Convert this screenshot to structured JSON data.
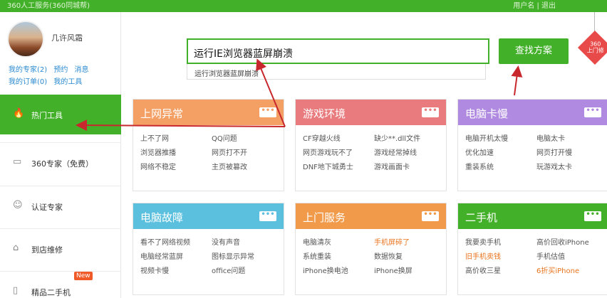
{
  "topbar": {
    "left_text": "360人工服务(360同城帮)",
    "right_text": "用户名 | 退出"
  },
  "user": {
    "name": "几许风霜",
    "links_row1": [
      "我的专家(2)",
      "预约",
      "消息"
    ],
    "links_row2": [
      "我的订单(0)",
      "我的工具"
    ]
  },
  "nav": [
    {
      "label": "热门工具",
      "icon": "fire-icon",
      "glyph": "🔥"
    },
    {
      "label": "360专家（免费）",
      "icon": "monitor-icon",
      "glyph": "▭"
    },
    {
      "label": "认证专家",
      "icon": "person-icon",
      "glyph": "☺"
    },
    {
      "label": "到店维修",
      "icon": "store-icon",
      "glyph": "⌂"
    },
    {
      "label": "精品二手机",
      "icon": "phone-icon",
      "glyph": "▯",
      "badge": "New"
    }
  ],
  "search": {
    "value": "运行IE浏览器蓝屏崩溃",
    "suggestion": "运行浏览器蓝屏崩溃",
    "button": "查找方案"
  },
  "badge360": {
    "line1": "360",
    "line2": "上门修"
  },
  "more_label": "•••",
  "colors": {
    "green": "#43b02a",
    "orange": "#f4a065",
    "pink": "#e97b7e",
    "purple": "#b08ae0",
    "blue": "#5bc0de",
    "orange2": "#f09a4a",
    "green2": "#43b02a",
    "arrow": "#c8282d"
  },
  "cards": [
    {
      "title": "上网异常",
      "color": "#f4a065",
      "items": [
        [
          "上不了网",
          "QQ问题"
        ],
        [
          "浏览器推播",
          "网页打不开"
        ],
        [
          "网络不稳定",
          "主页被篡改"
        ]
      ]
    },
    {
      "title": "游戏环境",
      "color": "#e97b7e",
      "items": [
        [
          "CF穿越火线",
          "缺少**.dll文件"
        ],
        [
          "网页游戏玩不了",
          "游戏经常掉线"
        ],
        [
          "DNF地下城勇士",
          "游戏画面卡"
        ]
      ]
    },
    {
      "title": "电脑卡慢",
      "color": "#b08ae0",
      "items": [
        [
          "电脑开机太慢",
          "电脑太卡"
        ],
        [
          "优化加速",
          "网页打开慢"
        ],
        [
          "重装系统",
          "玩游戏太卡"
        ]
      ]
    },
    {
      "title": "电脑故障",
      "color": "#5bc0de",
      "items": [
        [
          "看不了网络视频",
          "没有声音"
        ],
        [
          "电脑经常蓝屏",
          "图标显示异常"
        ],
        [
          "视频卡慢",
          "office问题"
        ]
      ]
    },
    {
      "title": "上门服务",
      "color": "#f09a4a",
      "items": [
        [
          "电脑清灰",
          "手机屏碎了"
        ],
        [
          "系统重装",
          "数据恢复"
        ],
        [
          "iPhone换电池",
          "iPhone换屏"
        ]
      ],
      "highlight": [
        [
          0,
          1
        ]
      ]
    },
    {
      "title": "二手机",
      "color": "#43b02a",
      "items": [
        [
          "我要卖手机",
          "高价回收iPhone"
        ],
        [
          "旧手机卖钱",
          "手机估值"
        ],
        [
          "高价收三星",
          "6折买iPhone"
        ]
      ],
      "highlight": [
        [
          1,
          0
        ],
        [
          2,
          1
        ]
      ]
    }
  ]
}
